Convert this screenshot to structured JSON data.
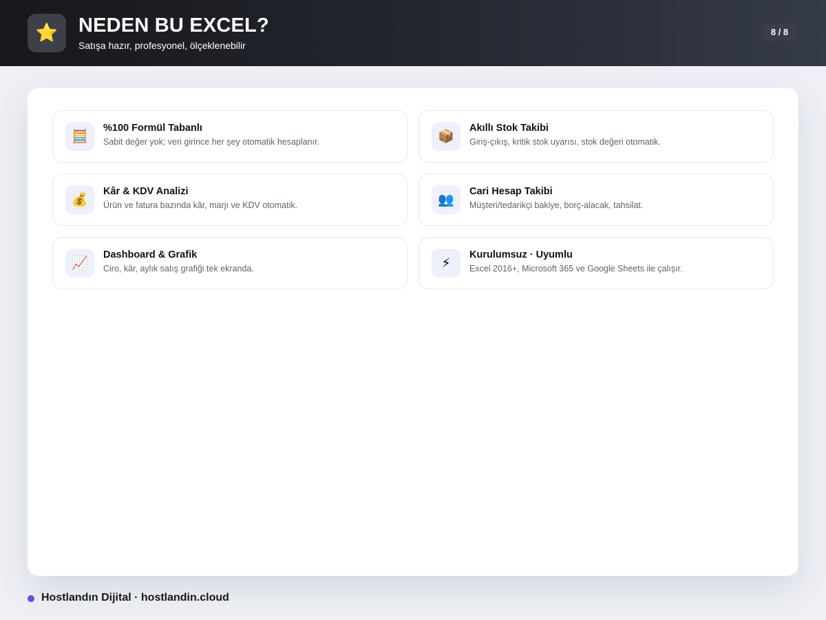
{
  "header": {
    "logo_icon": "star-icon",
    "logo_glyph": "⭐",
    "title": "NEDEN BU EXCEL?",
    "subtitle": "Satışa hazır, profesyonel, ölçeklenebilir",
    "page_indicator": "8 / 8"
  },
  "features": [
    {
      "icon": "abacus-icon",
      "glyph": "🧮",
      "title": "%100 Formül Tabanlı",
      "description": "Sabit değer yok; veri girince her şey otomatik hesaplanır."
    },
    {
      "icon": "package-icon",
      "glyph": "📦",
      "title": "Akıllı Stok Takibi",
      "description": "Giriş-çıkış, kritik stok uyarısı, stok değeri otomatik."
    },
    {
      "icon": "money-bag-icon",
      "glyph": "💰",
      "title": "Kâr & KDV Analizi",
      "description": "Ürün ve fatura bazında kâr, marjı ve KDV otomatik."
    },
    {
      "icon": "people-icon",
      "glyph": "👥",
      "title": "Cari Hesap Takibi",
      "description": "Müşteri/tedarikçi bakiye, borç-alacak, tahsilat."
    },
    {
      "icon": "chart-increasing-icon",
      "glyph": "📈",
      "title": "Dashboard & Grafik",
      "description": "Ciro, kâr, aylık satış grafiği tek ekranda."
    },
    {
      "icon": "lightning-icon",
      "glyph": "⚡",
      "title": "Kurulumsuz · Uyumlu",
      "description": "Excel 2016+, Microsoft 365 ve Google Sheets ile çalışır."
    }
  ],
  "footer": {
    "text": "Hostlandın Dijital · hostlandin.cloud",
    "dot_color": "#6d45f0"
  }
}
